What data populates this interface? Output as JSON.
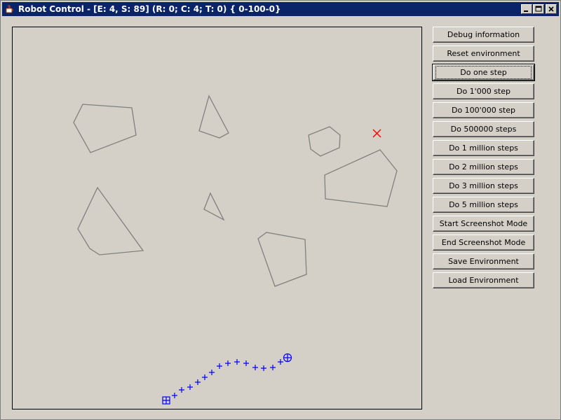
{
  "window": {
    "title": "Robot Control - [E: 4, S: 89] (R: 0; C: 4; T: 0) { 0-100-0}",
    "icon": "java-cup-icon"
  },
  "buttons": [
    {
      "label": "Debug information"
    },
    {
      "label": "Reset environment"
    },
    {
      "label": "Do one step"
    },
    {
      "label": "Do 1'000 step"
    },
    {
      "label": "Do 100'000 step"
    },
    {
      "label": "Do 500000 steps"
    },
    {
      "label": "Do 1 million steps"
    },
    {
      "label": "Do 2 million steps"
    },
    {
      "label": "Do 3 million steps"
    },
    {
      "label": "Do 5 million steps"
    },
    {
      "label": "Start Screenshot Mode"
    },
    {
      "label": "End Screenshot Mode"
    },
    {
      "label": "Save Environment"
    },
    {
      "label": "Load Environment"
    }
  ],
  "focused_button": "Do one step",
  "colors": {
    "obstacle": "#808080",
    "goal": "#ff0000",
    "path": "#0000ff",
    "titlebar": "#0a246a"
  }
}
